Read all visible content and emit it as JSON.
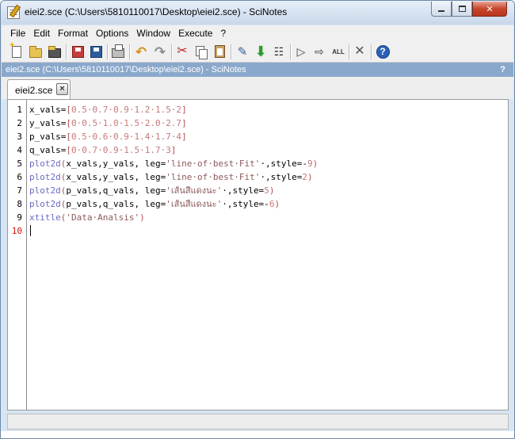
{
  "window": {
    "title": "eiei2.sce (C:\\Users\\5810110017\\Desktop\\eiei2.sce) - SciNotes"
  },
  "menu": [
    "File",
    "Edit",
    "Format",
    "Options",
    "Window",
    "Execute",
    "?"
  ],
  "toolbar": {
    "icons": [
      "new-file-icon",
      "open-file-icon",
      "open-folder-icon",
      "save-icon",
      "save-as-icon",
      "print-icon",
      "undo-icon",
      "redo-icon",
      "cut-icon",
      "copy-icon",
      "paste-icon",
      "find-icon",
      "execute-file-icon",
      "tree-icon",
      "run-icon",
      "run-selection-icon",
      "execute-all-icon",
      "settings-icon",
      "help-icon"
    ],
    "abc_label": "ALL"
  },
  "pathbar": {
    "text": "eiei2.sce (C:\\Users\\5810110017\\Desktop\\eiei2.sce) - SciNotes",
    "help": "?"
  },
  "tabs": [
    {
      "label": "eiei2.sce",
      "close": "×"
    }
  ],
  "editor": {
    "line_numbers": [
      "1",
      "2",
      "3",
      "4",
      "5",
      "6",
      "7",
      "8",
      "9",
      "10"
    ],
    "current_line": "10",
    "lines": [
      [
        {
          "t": "id",
          "v": "x_vals="
        },
        {
          "t": "br",
          "v": "["
        },
        {
          "t": "num",
          "v": "0.5·0.7·0.9·1.2·1.5·2"
        },
        {
          "t": "br",
          "v": "]"
        }
      ],
      [
        {
          "t": "id",
          "v": "y_vals="
        },
        {
          "t": "br",
          "v": "["
        },
        {
          "t": "num",
          "v": "0·0.5·1.0·1.5·2.0·2.7"
        },
        {
          "t": "br",
          "v": "]"
        }
      ],
      [
        {
          "t": "id",
          "v": "p_vals="
        },
        {
          "t": "br",
          "v": "["
        },
        {
          "t": "num",
          "v": "0.5·0.6·0.9·1.4·1.7·4"
        },
        {
          "t": "br",
          "v": "]"
        }
      ],
      [
        {
          "t": "id",
          "v": "q_vals="
        },
        {
          "t": "br",
          "v": "["
        },
        {
          "t": "num",
          "v": "0·0.7·0.9·1.5·1.7·3"
        },
        {
          "t": "br",
          "v": "]"
        }
      ],
      [
        {
          "t": "fn",
          "v": "plot2d"
        },
        {
          "t": "br",
          "v": "("
        },
        {
          "t": "id",
          "v": "x_vals,y_vals, leg="
        },
        {
          "t": "str",
          "v": "'line·of·best·Fit'"
        },
        {
          "t": "id",
          "v": "·,style=-"
        },
        {
          "t": "num",
          "v": "9"
        },
        {
          "t": "br",
          "v": ")"
        }
      ],
      [
        {
          "t": "fn",
          "v": "plot2d"
        },
        {
          "t": "br",
          "v": "("
        },
        {
          "t": "id",
          "v": "x_vals,y_vals, leg="
        },
        {
          "t": "str",
          "v": "'line·of·best·Fit'"
        },
        {
          "t": "id",
          "v": "·,style="
        },
        {
          "t": "num",
          "v": "2"
        },
        {
          "t": "br",
          "v": ")"
        }
      ],
      [
        {
          "t": "fn",
          "v": "plot2d"
        },
        {
          "t": "br",
          "v": "("
        },
        {
          "t": "id",
          "v": "p_vals,q_vals, leg="
        },
        {
          "t": "str",
          "v": "'เส้นสีแดงนะ'"
        },
        {
          "t": "id",
          "v": "·,style="
        },
        {
          "t": "num",
          "v": "5"
        },
        {
          "t": "br",
          "v": ")"
        }
      ],
      [
        {
          "t": "fn",
          "v": "plot2d"
        },
        {
          "t": "br",
          "v": "("
        },
        {
          "t": "id",
          "v": "p_vals,q_vals, leg="
        },
        {
          "t": "str",
          "v": "'เส้นสีแดงนะ'"
        },
        {
          "t": "id",
          "v": "·,style=-"
        },
        {
          "t": "num",
          "v": "6"
        },
        {
          "t": "br",
          "v": ")"
        }
      ],
      [
        {
          "t": "fn",
          "v": "xtitle"
        },
        {
          "t": "br",
          "v": "("
        },
        {
          "t": "str",
          "v": "'Data·Analsis'"
        },
        {
          "t": "br",
          "v": ")"
        }
      ],
      []
    ]
  },
  "colors": {
    "identifier": "#000000",
    "number": "#c87878",
    "bracket": "#b45050",
    "function": "#6a6ac6",
    "string": "#8c5a5a",
    "current_line_number": "#d01010",
    "pathbar_bg": "#8aa8cc"
  }
}
